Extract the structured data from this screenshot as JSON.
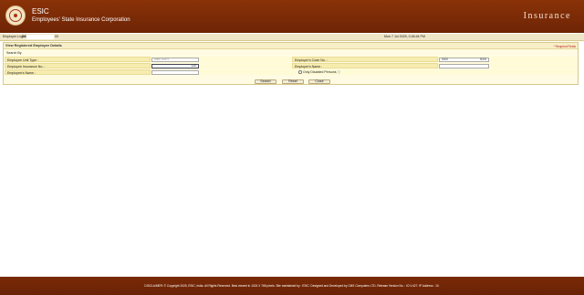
{
  "header": {
    "org_short": "ESIC",
    "org_full": "Employees' State Insurance Corporation",
    "brand": "Insurance"
  },
  "userbar": {
    "label": "Employer Login",
    "user_prefix": "590",
    "user_suffix": "00",
    "datetime": "Mon 7 Jul 2025, 0:46:44 PM"
  },
  "panel": {
    "title": "View Registered Employee Details",
    "required_note": "* Required Fields",
    "search_by": "Search By"
  },
  "form": {
    "unit_type_label": "Employee Unit Type :",
    "unit_type_value": "Main Unit",
    "code_label": "Employer's Code No. :",
    "code_prefix": "5000",
    "code_suffix": "5006",
    "ip_label": "Employee Insurance No. :",
    "ip_value": "120",
    "employer_name_label": "Employer's Name :",
    "employer_name_value": "",
    "employee_name_label": "Employee's Name :",
    "employee_name_value": "",
    "disabled_label": "Only Disabled Persons",
    "disabled_icon": "help-icon"
  },
  "buttons": {
    "search": "Search",
    "reset": "Reset",
    "close": "Close"
  },
  "footer": {
    "disclaimer": "DISCLAIMER: © Copyright 2025, ESIC, India. All Rights Reserved. Best viewed in 1024 X 768 pixels. Site maintained by : ESIC. Designed and Developed by CMS Computers LTD. Release Version No. : IO.V.427. IP Address : 10."
  },
  "colors": {
    "header_bg": "#7a2a06",
    "panel_bg": "#fffbe3",
    "label_bg": "#f7ecb0"
  }
}
